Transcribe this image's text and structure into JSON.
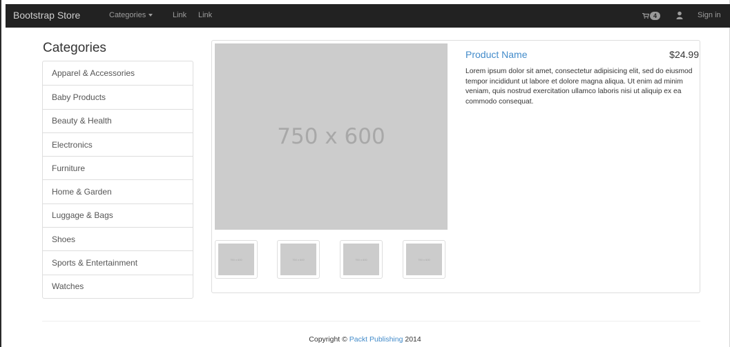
{
  "navbar": {
    "brand": "Bootstrap Store",
    "categories_label": "Categories",
    "links": [
      "Link",
      "Link"
    ],
    "cart": {
      "icon": "cart-icon",
      "count": "4"
    },
    "user_icon": "user-icon",
    "sign_in": "Sign in"
  },
  "sidebar": {
    "heading": "Categories",
    "items": [
      {
        "label": "Apparel & Accessories"
      },
      {
        "label": "Baby Products"
      },
      {
        "label": "Beauty & Health"
      },
      {
        "label": "Electronics"
      },
      {
        "label": "Furniture"
      },
      {
        "label": "Home & Garden"
      },
      {
        "label": "Luggage & Bags"
      },
      {
        "label": "Shoes"
      },
      {
        "label": "Sports & Entertainment"
      },
      {
        "label": "Watches"
      }
    ]
  },
  "product": {
    "image_placeholder": "750 x 600",
    "thumbnails": [
      {
        "label": "750 x 600"
      },
      {
        "label": "750 x 600"
      },
      {
        "label": "750 x 600"
      },
      {
        "label": "750 x 600"
      }
    ],
    "name": "Product Name",
    "price": "$24.99",
    "description": "Lorem ipsum dolor sit amet, consectetur adipisicing elit, sed do eiusmod tempor incididunt ut labore et dolore magna aliqua. Ut enim ad minim veniam, quis nostrud exercitation ullamco laboris nisi ut aliquip ex ea commodo consequat."
  },
  "footer": {
    "prefix": "Copyright © ",
    "link": "Packt Publishing",
    "suffix": " 2014"
  },
  "colors": {
    "navbar_bg": "#222222",
    "link": "#428bca",
    "placeholder_bg": "#cccccc"
  }
}
